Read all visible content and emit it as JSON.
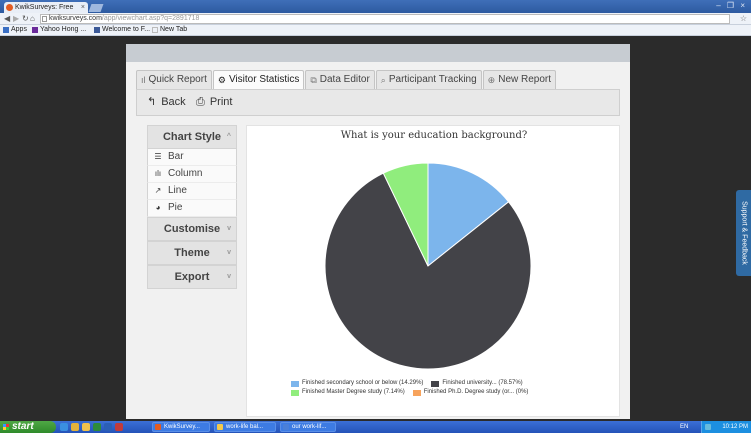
{
  "browser": {
    "tab_title": "KwikSurveys: Free",
    "tab_close": "×",
    "window_controls": "– ❐ ×",
    "url_host": "kwiksurveys.com",
    "url_path": "/app/viewchart.asp?q=2891718",
    "bookmarks": [
      {
        "label": "Apps",
        "color": "#3a6fc4"
      },
      {
        "label": "Yahoo Hong ...",
        "color": "#6a2a9a"
      },
      {
        "label": "Welcome to F...",
        "color": "#3b5998"
      },
      {
        "label": "New Tab",
        "color": "#bbbbbb"
      }
    ]
  },
  "tabs": [
    {
      "icon": "bar-chart-icon",
      "glyph": "ıl",
      "label": "Quick Report"
    },
    {
      "icon": "gear-icon",
      "glyph": "⚙",
      "label": "Visitor Statistics",
      "active": true
    },
    {
      "icon": "edit-icon",
      "glyph": "⧉",
      "label": "Data Editor"
    },
    {
      "icon": "search-icon",
      "glyph": "⌕",
      "label": "Participant Tracking"
    },
    {
      "icon": "plus-icon",
      "glyph": "⊕",
      "label": "New Report"
    }
  ],
  "toolbar": {
    "back_label": "Back",
    "print_label": "Print"
  },
  "sidebar": {
    "chart_style_label": "Chart Style",
    "items": [
      {
        "glyph": "☰",
        "label": "Bar"
      },
      {
        "glyph": "ılı",
        "label": "Column"
      },
      {
        "glyph": "↗",
        "label": "Line"
      },
      {
        "glyph": "◕",
        "label": "Pie"
      }
    ],
    "customise_label": "Customise",
    "theme_label": "Theme",
    "export_label": "Export"
  },
  "support_label": "Support & Feedback",
  "chart_data": {
    "type": "pie",
    "title": "What is your education background?",
    "slices": [
      {
        "label": "Finished secondary school or below (14.29%)",
        "value": 14.29,
        "color": "#7cb5ec"
      },
      {
        "label": "Finished university... (78.57%)",
        "value": 78.57,
        "color": "#434348"
      },
      {
        "label": "Finished Master Degree study (7.14%)",
        "value": 7.14,
        "color": "#90ed7d"
      },
      {
        "label": "Finished Ph.D. Degree study (or... (0%)",
        "value": 0,
        "color": "#f7a35c"
      }
    ]
  },
  "taskbar": {
    "start_label": "start",
    "tasks": [
      {
        "label": "KwikSurvey...",
        "color": "#e25b22"
      },
      {
        "label": "work-life bal...",
        "color": "#f2c94c"
      },
      {
        "label": "our work-lif...",
        "color": "#4a7fd8"
      }
    ],
    "lang": "EN",
    "clock": "10:12 PM"
  }
}
